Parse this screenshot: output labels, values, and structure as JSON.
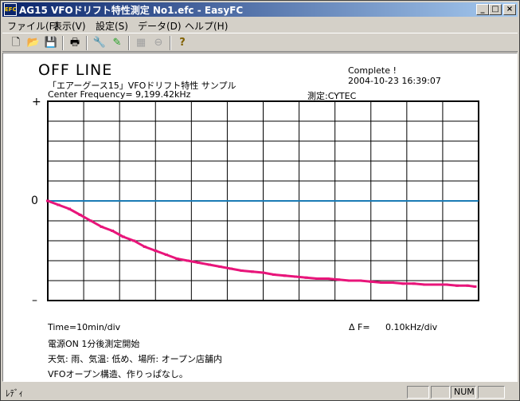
{
  "window": {
    "title": "AG15  VFOドリフト特性測定  No1.efc - EasyFC",
    "icon_text": "EFC",
    "minimize": "_",
    "maximize": "□",
    "close": "×"
  },
  "menu": [
    {
      "label": "ファイル(F)"
    },
    {
      "label": "表示(V)"
    },
    {
      "label": "設定(S)"
    },
    {
      "label": "データ(D)"
    },
    {
      "label": "ヘルプ(H)"
    }
  ],
  "toolbar": {
    "icons": [
      "new-file-icon",
      "open-folder-icon",
      "save-icon",
      "print-icon",
      "wrench-icon",
      "pen-icon",
      "graph-icon",
      "stop-icon",
      "help-icon"
    ]
  },
  "graph": {
    "status": "OFF LINE",
    "complete": "Complete !",
    "datetime": "2004-10-23  16:39:07",
    "subject": "「エアーグース15」VFOドリフト特性  サンプル",
    "center_freq": "Center Frequency=  9,199.42kHz",
    "measured_by": "測定:CYTEC",
    "axis_plus": "+",
    "axis_zero": "0",
    "axis_minus": "–",
    "time_div": "Time=10min/div",
    "delta_f_label": "Δ F=",
    "delta_f_value": "0.10kHz/div",
    "note1": "電源ON  1分後測定開始",
    "note2": "天気: 雨、気温: 低め、場所: オープン店舗内",
    "note3": "VFOオープン構造、作りっぱなし。"
  },
  "chart_data": {
    "type": "line",
    "grid": true,
    "x_unit": "min",
    "y_unit": "kHz",
    "xlim": [
      0,
      120
    ],
    "ylim": [
      -0.5,
      0.5
    ],
    "series": [
      {
        "color": "#e8157a",
        "x": [
          0,
          3,
          6,
          9,
          12,
          15,
          18,
          21,
          24,
          27,
          30,
          33,
          36,
          39,
          42,
          45,
          48,
          51,
          54,
          57,
          60,
          63,
          66,
          69,
          72,
          75,
          78,
          81,
          84,
          87,
          90,
          93,
          96,
          99,
          102,
          105,
          108,
          111,
          114,
          117,
          119
        ],
        "y": [
          0.0,
          -0.02,
          -0.04,
          -0.07,
          -0.1,
          -0.13,
          -0.15,
          -0.18,
          -0.2,
          -0.23,
          -0.25,
          -0.27,
          -0.29,
          -0.3,
          -0.31,
          -0.32,
          -0.33,
          -0.34,
          -0.35,
          -0.355,
          -0.36,
          -0.37,
          -0.375,
          -0.38,
          -0.385,
          -0.39,
          -0.39,
          -0.395,
          -0.4,
          -0.4,
          -0.405,
          -0.41,
          -0.41,
          -0.415,
          -0.415,
          -0.42,
          -0.42,
          -0.42,
          -0.425,
          -0.425,
          -0.43
        ]
      }
    ],
    "baseline": {
      "y": 0.0,
      "color": "#1a7bb5"
    },
    "grid_color": "#000000"
  },
  "statusbar": {
    "text": "ﾚﾃﾞｨ",
    "num": "NUM"
  }
}
